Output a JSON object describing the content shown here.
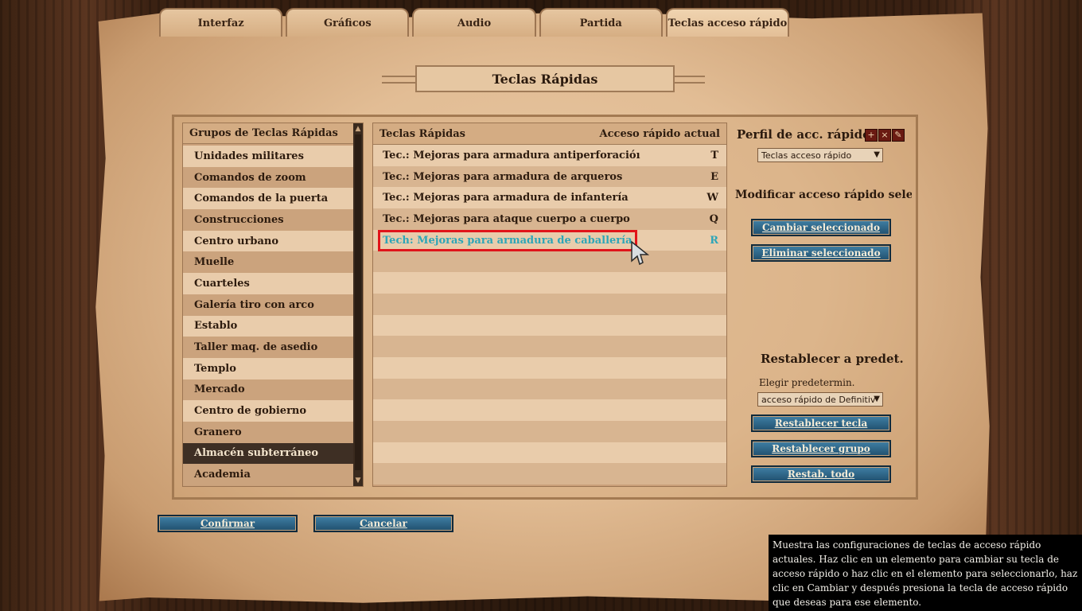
{
  "tabs": [
    "Interfaz",
    "Gráficos",
    "Audio",
    "Partida",
    "Teclas acceso rápido"
  ],
  "title": "Teclas Rápidas",
  "groups": {
    "header": "Grupos de Teclas Rápidas",
    "items": [
      "Unidades militares",
      "Comandos de zoom",
      "Comandos de la puerta",
      "Construcciones",
      "Centro urbano",
      "Muelle",
      "Cuarteles",
      "Galería tiro con arco",
      "Establo",
      "Taller maq. de asedio",
      "Templo",
      "Mercado",
      "Centro de gobierno",
      "Granero",
      "Almacén subterráneo",
      "Academia"
    ],
    "selected_index": 14
  },
  "hotkeys": {
    "header_name": "Teclas Rápidas",
    "header_key": "Acceso rápido actual",
    "items": [
      {
        "name": "Tec.: Mejoras para armadura antiperforacióı",
        "key": "T"
      },
      {
        "name": "Tec.: Mejoras para armadura de arqueros",
        "key": "E"
      },
      {
        "name": "Tec.: Mejoras para armadura de infantería",
        "key": "W"
      },
      {
        "name": "Tec.: Mejoras para ataque cuerpo a cuerpo",
        "key": "Q"
      },
      {
        "name": "Tech: Mejoras para armadura de caballería",
        "key": "R"
      }
    ],
    "selected_index": 4
  },
  "right": {
    "profile_title": "Perfil de acc. rápidos",
    "profile_value": "Teclas acceso rápido",
    "modify_title": "Modificar acceso rápido selec",
    "change_btn": "Cambiar seleccionado",
    "delete_btn": "Eliminar seleccionado",
    "reset_title": "Restablecer a predet.",
    "choose_label": "Elegir predetermin.",
    "choose_value": "acceso rápido de Definitiv",
    "reset_key_btn": "Restablecer tecla",
    "reset_group_btn": "Restablecer grupo",
    "reset_all_btn": "Restab. todo",
    "icons": [
      "add-icon",
      "delete-icon",
      "edit-icon"
    ]
  },
  "footer": {
    "confirm": "Confirmar",
    "cancel": "Cancelar"
  },
  "tooltip": "Muestra las configuraciones de teclas de acceso rápido actuales. Haz clic en un elemento para cambiar su tecla de acceso rápido o haz clic en el elemento para seleccionarlo, haz clic en Cambiar y después presiona la tecla de acceso rápido que deseas para ese elemento."
}
